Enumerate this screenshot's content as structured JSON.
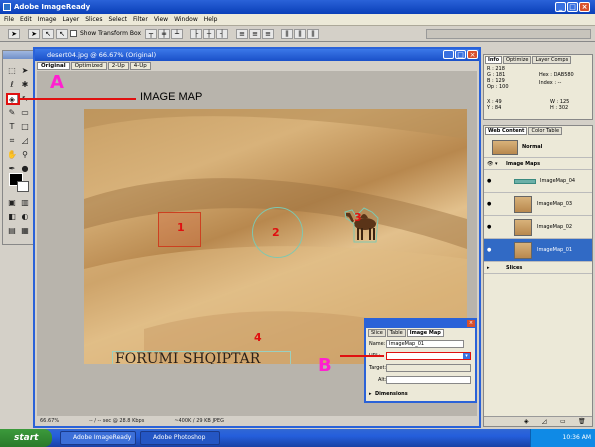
{
  "window": {
    "title": "Adobe ImageReady",
    "min": "_",
    "max": "□",
    "close": "×"
  },
  "menu": [
    "File",
    "Edit",
    "Image",
    "Layer",
    "Slices",
    "Select",
    "Filter",
    "View",
    "Window",
    "Help"
  ],
  "options_bar": {
    "show_transform_box": "Show Transform Box"
  },
  "document": {
    "title": "desert04.jpg @ 66.67% (Original)",
    "tabs": [
      "Original",
      "Optimized",
      "2-Up",
      "4-Up"
    ],
    "active_tab": "Original",
    "status": [
      "66.67%",
      "-- / -- sec @ 28.8 Kbps",
      "~400K / 29 KB JPEG"
    ],
    "image_text": "FORUMI SHQIPTAR",
    "map_numbers": [
      "1",
      "2",
      "3",
      "4"
    ]
  },
  "info_panel": {
    "tabs": [
      "Info",
      "Optimize",
      "Layer Comps"
    ],
    "r": "R :",
    "r_val": "218",
    "g": "G :",
    "g_val": "181",
    "b": "B :",
    "b_val": "129",
    "op": "Op :",
    "op_val": "100",
    "hex": "Hex :",
    "hex_val": "DAB580",
    "index": "Index :",
    "index_val": "--",
    "x": "X :",
    "x_val": "49",
    "y": "Y :",
    "y_val": "84",
    "w": "W :",
    "w_val": "125",
    "h": "H :",
    "h_val": "302"
  },
  "web_panel": {
    "tabs": [
      "Web Content",
      "Color Table"
    ],
    "normal": "Normal",
    "image_maps": "Image Maps",
    "maps": [
      "ImageMap_04",
      "ImageMap_03",
      "ImageMap_02",
      "ImageMap_01"
    ],
    "slices": "Slices"
  },
  "image_map_palette": {
    "tabs": [
      "Slice",
      "Table",
      "Image Map"
    ],
    "name_label": "Name:",
    "name_value": "ImageMap_01",
    "url_label": "URL:",
    "url_value": "",
    "target_label": "Target:",
    "alt_label": "Alt:",
    "dimensions": "Dimensions"
  },
  "annotations": {
    "a": "A",
    "b": "B",
    "image_map": "IMAGE MAP"
  },
  "taskbar": {
    "start": "start",
    "tasks": [
      "Adobe ImageReady",
      "Adobe Photoshop"
    ],
    "clock": "10:36 AM"
  },
  "colors": {
    "xp_blue": "#2a62d8",
    "annotation_red": "#e01010",
    "annotation_magenta": "#ff20d0"
  }
}
